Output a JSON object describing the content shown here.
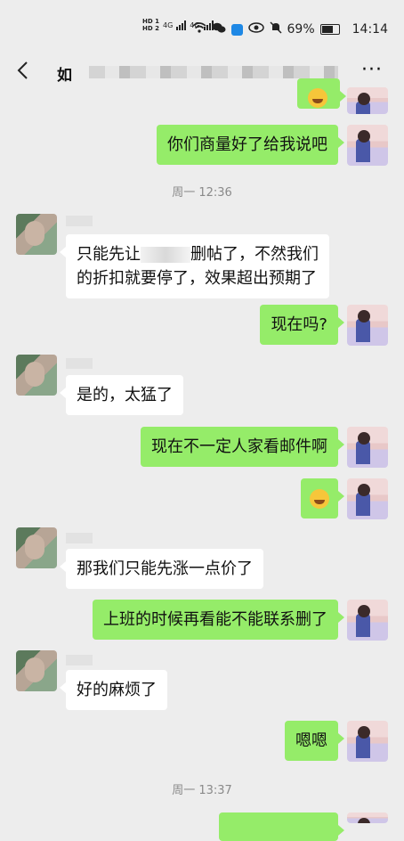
{
  "status_bar": {
    "hd_top": "HD 1",
    "hd_bottom": "HD 2",
    "net1": "4G",
    "net2": "4G",
    "battery": "69%",
    "time": "14:14"
  },
  "header": {
    "title_visible": "如",
    "more": "···"
  },
  "messages": [
    {
      "side": "out",
      "text": "你们商量好了给我说吧"
    },
    {
      "side": "time",
      "text": "周一 12:36"
    },
    {
      "side": "in",
      "line1_a": "只能先让",
      "line1_b": "删帖了，不然我们",
      "line2": "的折扣就要停了，效果超出预期了"
    },
    {
      "side": "out",
      "text": "现在吗?"
    },
    {
      "side": "in",
      "text": "是的，太猛了"
    },
    {
      "side": "out",
      "text": "现在不一定人家看邮件啊"
    },
    {
      "side": "out",
      "emoji": "laughing-crying-emoji"
    },
    {
      "side": "in",
      "text": "那我们只能先涨一点价了"
    },
    {
      "side": "out",
      "text": "上班的时候再看能不能联系删了"
    },
    {
      "side": "in",
      "text": "好的麻烦了"
    },
    {
      "side": "out",
      "text": "嗯嗯"
    },
    {
      "side": "time",
      "text": "周一 13:37"
    }
  ]
}
